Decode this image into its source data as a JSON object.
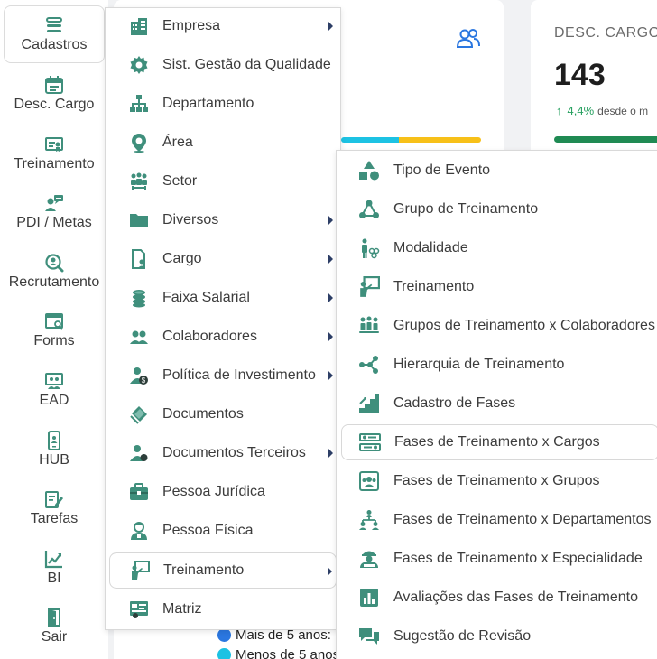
{
  "colors": {
    "accent": "#3f8f7c",
    "blue": "#2b77e0",
    "cyan": "#1cc2e3",
    "yellow": "#f7c018",
    "green": "#1f8a53"
  },
  "sidebar": {
    "items": [
      {
        "label": "Cadastros",
        "icon": "list-icon"
      },
      {
        "label": "Desc. Cargo",
        "icon": "calendar-icon"
      },
      {
        "label": "Treinamento",
        "icon": "certificate-icon"
      },
      {
        "label": "PDI / Metas",
        "icon": "person-chat-icon"
      },
      {
        "label": "Recrutamento",
        "icon": "search-person-icon"
      },
      {
        "label": "Forms",
        "icon": "form-icon"
      },
      {
        "label": "EAD",
        "icon": "presentation-icon"
      },
      {
        "label": "HUB",
        "icon": "phone-icon"
      },
      {
        "label": "Tarefas",
        "icon": "edit-icon"
      },
      {
        "label": "BI",
        "icon": "chart-icon"
      },
      {
        "label": "Sair",
        "icon": "door-icon"
      }
    ]
  },
  "dashboard": {
    "desc_cargo": {
      "title": "DESC. CARGO",
      "value": "143",
      "trend_pct": "4,4%",
      "trend_text": "desde o m"
    },
    "legend": [
      {
        "label": "Mais de 5 anos:",
        "color": "#2b77e0"
      },
      {
        "label": "Menos de 5 anos",
        "color": "#1cc2e3"
      }
    ]
  },
  "menu_cadastros": {
    "items": [
      {
        "label": "Empresa",
        "icon": "building-icon",
        "submenu": true
      },
      {
        "label": "Sist. Gestão da Qualidade",
        "icon": "gear-icon",
        "submenu": false
      },
      {
        "label": "Departamento",
        "icon": "org-chart-icon",
        "submenu": false
      },
      {
        "label": "Área",
        "icon": "map-pin-icon",
        "submenu": false
      },
      {
        "label": "Setor",
        "icon": "group-icon",
        "submenu": false
      },
      {
        "label": "Diversos",
        "icon": "folder-icon",
        "submenu": true
      },
      {
        "label": "Cargo",
        "icon": "document-person-icon",
        "submenu": true
      },
      {
        "label": "Faixa Salarial",
        "icon": "coins-icon",
        "submenu": true
      },
      {
        "label": "Colaboradores",
        "icon": "users-icon",
        "submenu": true
      },
      {
        "label": "Política de Investimento",
        "icon": "person-money-icon",
        "submenu": true
      },
      {
        "label": "Documentos",
        "icon": "documents-icon",
        "submenu": false
      },
      {
        "label": "Documentos Terceiros",
        "icon": "person-doc-icon",
        "submenu": true
      },
      {
        "label": "Pessoa Jurídica",
        "icon": "briefcase-icon",
        "submenu": false
      },
      {
        "label": "Pessoa Física",
        "icon": "person-icon",
        "submenu": false
      },
      {
        "label": "Treinamento",
        "icon": "teacher-icon",
        "submenu": true
      },
      {
        "label": "Matriz",
        "icon": "matrix-icon",
        "submenu": false
      }
    ]
  },
  "menu_treinamento": {
    "items": [
      {
        "label": "Tipo de Evento",
        "icon": "shapes-icon"
      },
      {
        "label": "Grupo de Treinamento",
        "icon": "group-triangle-icon"
      },
      {
        "label": "Modalidade",
        "icon": "modality-icon"
      },
      {
        "label": "Treinamento",
        "icon": "teacher-icon"
      },
      {
        "label": "Grupos de Treinamento x Colaboradores",
        "icon": "people-row-icon"
      },
      {
        "label": "Hierarquia de Treinamento",
        "icon": "hierarchy-icon"
      },
      {
        "label": "Cadastro de Fases",
        "icon": "stairs-icon"
      },
      {
        "label": "Fases de Treinamento x Cargos",
        "icon": "phases-cargos-icon"
      },
      {
        "label": "Fases de Treinamento x Grupos",
        "icon": "phases-groups-icon"
      },
      {
        "label": "Fases de Treinamento x Departamentos",
        "icon": "phases-departments-icon"
      },
      {
        "label": "Fases de Treinamento x Especialidade",
        "icon": "phases-specialty-icon"
      },
      {
        "label": "Avaliações das Fases de Treinamento",
        "icon": "bar-chart-icon"
      },
      {
        "label": "Sugestão de Revisão",
        "icon": "chat-icon"
      }
    ]
  }
}
